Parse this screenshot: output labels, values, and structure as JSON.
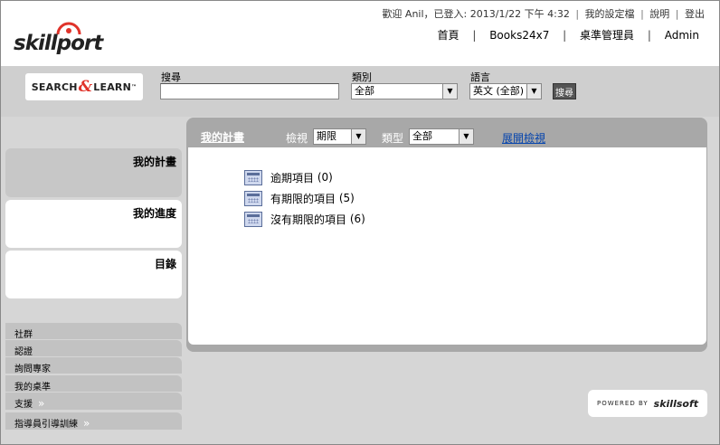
{
  "header": {
    "logo_text": "skillport",
    "welcome": "歡迎 Anil，已登入: 2013/1/22 下午 4:32",
    "top_links": [
      "我的設定檔",
      "說明",
      "登出"
    ],
    "nav": [
      "首頁",
      "Books24x7",
      "桌準管理員",
      "Admin"
    ]
  },
  "search": {
    "logo_left": "SEARCH",
    "logo_amp": "&",
    "logo_right": "LEARN",
    "logo_tm": "™",
    "query_label": "搜尋",
    "query_value": "",
    "category_label": "類別",
    "category_value": "全部",
    "language_label": "語言",
    "language_value": "英文 (全部)",
    "button_label": "搜尋"
  },
  "sidebar": {
    "sections": [
      "我的計畫",
      "我的進度",
      "目錄"
    ],
    "links": [
      {
        "label": "社群",
        "chev": ""
      },
      {
        "label": "認證",
        "chev": ""
      },
      {
        "label": "詢問專家",
        "chev": ""
      },
      {
        "label": "我的桌準",
        "chev": ""
      },
      {
        "label": "支援",
        "chev": "»"
      },
      {
        "label": "指導員引導訓練",
        "chev": "»"
      }
    ]
  },
  "plan": {
    "title": "我的計畫",
    "view_label": "檢視",
    "view_value": "期限",
    "type_label": "類型",
    "type_value": "全部",
    "expand_link": "展開檢視",
    "items": [
      {
        "label": "逾期項目",
        "count": "(0)"
      },
      {
        "label": "有期限的項目",
        "count": "(5)"
      },
      {
        "label": "沒有期限的項目",
        "count": "(6)"
      }
    ]
  },
  "footer": {
    "powered_by": "POWERED BY",
    "brand": "skillsoft"
  }
}
